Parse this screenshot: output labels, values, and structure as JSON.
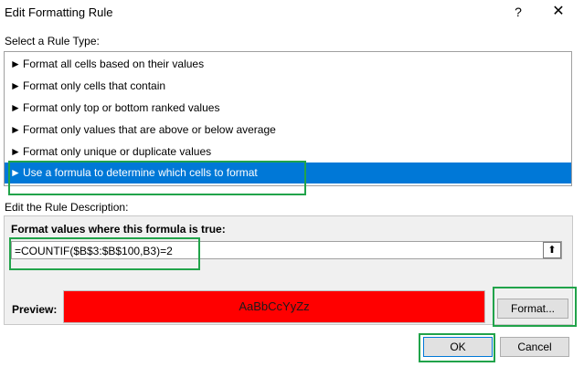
{
  "window": {
    "title": "Edit Formatting Rule",
    "help_label": "?",
    "close_label": "✕"
  },
  "rule_type": {
    "label": "Select a Rule Type:",
    "items": [
      {
        "label": "Format all cells based on their values"
      },
      {
        "label": "Format only cells that contain"
      },
      {
        "label": "Format only top or bottom ranked values"
      },
      {
        "label": "Format only values that are above or below average"
      },
      {
        "label": "Format only unique or duplicate values"
      },
      {
        "label": "Use a formula to determine which cells to format"
      }
    ],
    "selected_index": 5,
    "arrow_glyph": "►"
  },
  "description": {
    "label": "Edit the Rule Description:",
    "formula_label": "Format values where this formula is true:",
    "formula_value": "=COUNTIF($B$3:$B$100,B3)=2",
    "collapse_glyph": "⬆",
    "preview_label": "Preview:",
    "preview_text": "AaBbCcYyZz",
    "preview_fill": "#ff0000",
    "format_button": "Format..."
  },
  "footer": {
    "ok_label": "OK",
    "cancel_label": "Cancel"
  },
  "colors": {
    "selection": "#0078d7",
    "highlight": "#21a34a"
  }
}
